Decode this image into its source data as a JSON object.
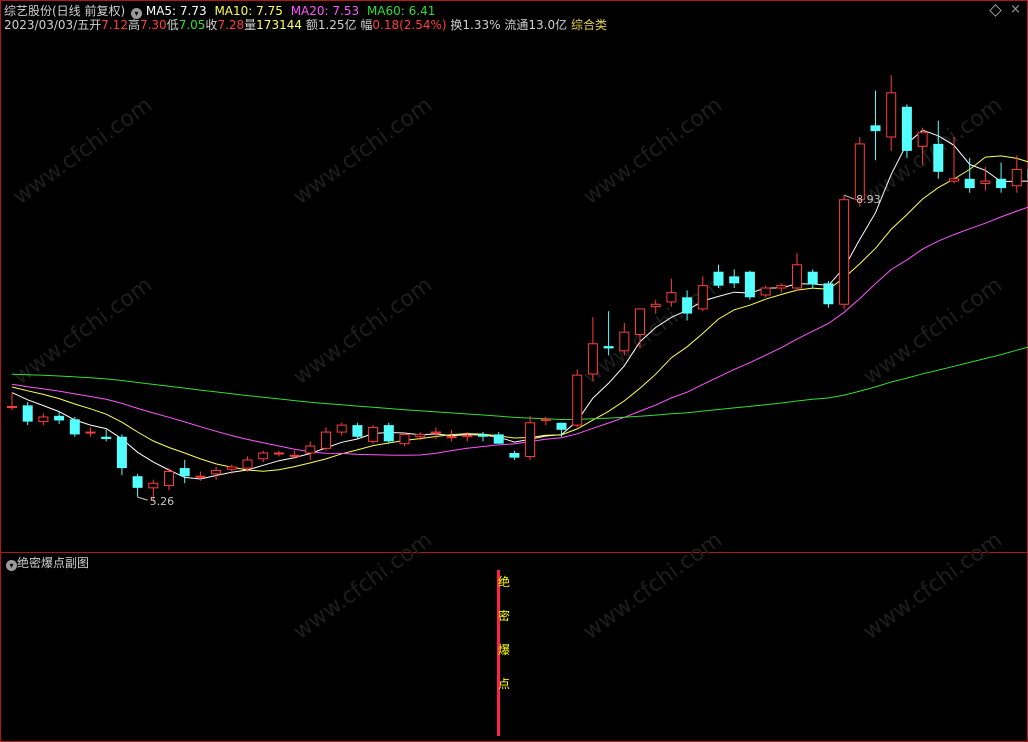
{
  "header": {
    "title": "综艺股份(日线 前复权)",
    "ma5": "MA5: 7.73",
    "ma10": "MA10: 7.75",
    "ma20": "MA20: 7.53",
    "ma60": "MA60: 6.41",
    "date": "2023/03/03/五",
    "open_label": "开",
    "open": "7.12",
    "high_label": "高",
    "high": "7.30",
    "low_label": "低",
    "low": "7.05",
    "close_label": "收",
    "close": "7.28",
    "vol_label": "量",
    "vol": "173144",
    "amount": "额1.25亿",
    "change_label": "幅",
    "change": "0.18(2.54%)",
    "turnover": "换1.33%",
    "float": "流通13.0亿",
    "sector": "综合类"
  },
  "sub_panel": {
    "title": "绝密爆点副图",
    "signal_chars": [
      "绝",
      "密",
      "爆",
      "点"
    ]
  },
  "watermark": "www.cfchi.com",
  "colors": {
    "up": "#ff3c3c",
    "down": "#54ffff",
    "ma5": "#ffffff",
    "ma10": "#ffff55",
    "ma20": "#ff55ff",
    "ma60": "#33dd33",
    "border": "#b01818",
    "signal": "#ff2244",
    "signal_text": "#ffff00"
  },
  "chart_data": {
    "type": "candlestick",
    "y_range_visible": [
      5.0,
      9.2
    ],
    "annotations": [
      {
        "label": "8.93",
        "candle_index": 53,
        "kind": "high"
      },
      {
        "label": "5.26",
        "candle_index": 8,
        "kind": "low"
      }
    ],
    "candles": [
      {
        "o": 6.08,
        "h": 6.2,
        "l": 6.05,
        "c": 6.08
      },
      {
        "o": 6.09,
        "h": 6.12,
        "l": 5.92,
        "c": 5.95
      },
      {
        "o": 5.95,
        "h": 6.02,
        "l": 5.92,
        "c": 5.99
      },
      {
        "o": 6.0,
        "h": 6.04,
        "l": 5.93,
        "c": 5.96
      },
      {
        "o": 5.97,
        "h": 5.99,
        "l": 5.82,
        "c": 5.84
      },
      {
        "o": 5.86,
        "h": 5.9,
        "l": 5.82,
        "c": 5.86
      },
      {
        "o": 5.82,
        "h": 5.88,
        "l": 5.78,
        "c": 5.8
      },
      {
        "o": 5.82,
        "h": 5.84,
        "l": 5.49,
        "c": 5.55
      },
      {
        "o": 5.48,
        "h": 5.5,
        "l": 5.3,
        "c": 5.38
      },
      {
        "o": 5.38,
        "h": 5.45,
        "l": 5.26,
        "c": 5.42
      },
      {
        "o": 5.4,
        "h": 5.55,
        "l": 5.36,
        "c": 5.52
      },
      {
        "o": 5.55,
        "h": 5.62,
        "l": 5.42,
        "c": 5.48
      },
      {
        "o": 5.48,
        "h": 5.52,
        "l": 5.44,
        "c": 5.48
      },
      {
        "o": 5.5,
        "h": 5.56,
        "l": 5.45,
        "c": 5.53
      },
      {
        "o": 5.54,
        "h": 5.58,
        "l": 5.5,
        "c": 5.56
      },
      {
        "o": 5.55,
        "h": 5.65,
        "l": 5.52,
        "c": 5.62
      },
      {
        "o": 5.63,
        "h": 5.7,
        "l": 5.6,
        "c": 5.68
      },
      {
        "o": 5.68,
        "h": 5.7,
        "l": 5.65,
        "c": 5.68
      },
      {
        "o": 5.66,
        "h": 5.7,
        "l": 5.63,
        "c": 5.66
      },
      {
        "o": 5.68,
        "h": 5.78,
        "l": 5.62,
        "c": 5.74
      },
      {
        "o": 5.72,
        "h": 5.9,
        "l": 5.7,
        "c": 5.86
      },
      {
        "o": 5.86,
        "h": 5.94,
        "l": 5.83,
        "c": 5.92
      },
      {
        "o": 5.92,
        "h": 5.94,
        "l": 5.8,
        "c": 5.82
      },
      {
        "o": 5.78,
        "h": 5.92,
        "l": 5.76,
        "c": 5.9
      },
      {
        "o": 5.92,
        "h": 5.94,
        "l": 5.76,
        "c": 5.78
      },
      {
        "o": 5.76,
        "h": 5.86,
        "l": 5.74,
        "c": 5.84
      },
      {
        "o": 5.82,
        "h": 5.86,
        "l": 5.79,
        "c": 5.84
      },
      {
        "o": 5.85,
        "h": 5.9,
        "l": 5.8,
        "c": 5.86
      },
      {
        "o": 5.82,
        "h": 5.88,
        "l": 5.78,
        "c": 5.82
      },
      {
        "o": 5.82,
        "h": 5.86,
        "l": 5.78,
        "c": 5.83
      },
      {
        "o": 5.84,
        "h": 5.86,
        "l": 5.78,
        "c": 5.82
      },
      {
        "o": 5.84,
        "h": 5.86,
        "l": 5.76,
        "c": 5.76
      },
      {
        "o": 5.68,
        "h": 5.7,
        "l": 5.62,
        "c": 5.64
      },
      {
        "o": 5.65,
        "h": 6.0,
        "l": 5.62,
        "c": 5.94
      },
      {
        "o": 5.96,
        "h": 5.99,
        "l": 5.92,
        "c": 5.97
      },
      {
        "o": 5.94,
        "h": 5.94,
        "l": 5.82,
        "c": 5.88
      },
      {
        "o": 5.92,
        "h": 6.4,
        "l": 5.9,
        "c": 6.35
      },
      {
        "o": 6.36,
        "h": 6.85,
        "l": 6.3,
        "c": 6.62
      },
      {
        "o": 6.6,
        "h": 6.9,
        "l": 6.52,
        "c": 6.58
      },
      {
        "o": 6.56,
        "h": 6.8,
        "l": 6.52,
        "c": 6.72
      },
      {
        "o": 6.7,
        "h": 6.92,
        "l": 6.58,
        "c": 6.92
      },
      {
        "o": 6.94,
        "h": 7.0,
        "l": 6.88,
        "c": 6.96
      },
      {
        "o": 6.98,
        "h": 7.18,
        "l": 6.94,
        "c": 7.06
      },
      {
        "o": 7.02,
        "h": 7.08,
        "l": 6.82,
        "c": 6.88
      },
      {
        "o": 6.92,
        "h": 7.2,
        "l": 6.9,
        "c": 7.12
      },
      {
        "o": 7.24,
        "h": 7.3,
        "l": 7.1,
        "c": 7.12
      },
      {
        "o": 7.2,
        "h": 7.26,
        "l": 7.1,
        "c": 7.14
      },
      {
        "o": 7.24,
        "h": 7.25,
        "l": 7.0,
        "c": 7.02
      },
      {
        "o": 7.04,
        "h": 7.12,
        "l": 7.02,
        "c": 7.1
      },
      {
        "o": 7.1,
        "h": 7.14,
        "l": 7.06,
        "c": 7.12
      },
      {
        "o": 7.1,
        "h": 7.4,
        "l": 7.08,
        "c": 7.3
      },
      {
        "o": 7.24,
        "h": 7.26,
        "l": 7.1,
        "c": 7.13
      },
      {
        "o": 7.14,
        "h": 7.16,
        "l": 6.93,
        "c": 6.96
      },
      {
        "o": 6.96,
        "h": 7.9,
        "l": 6.92,
        "c": 7.86
      },
      {
        "o": 7.86,
        "h": 8.4,
        "l": 7.8,
        "c": 8.34
      },
      {
        "o": 8.5,
        "h": 8.8,
        "l": 8.2,
        "c": 8.45
      },
      {
        "o": 8.4,
        "h": 8.93,
        "l": 8.28,
        "c": 8.78
      },
      {
        "o": 8.66,
        "h": 8.68,
        "l": 8.22,
        "c": 8.28
      },
      {
        "o": 8.32,
        "h": 8.48,
        "l": 8.16,
        "c": 8.44
      },
      {
        "o": 8.34,
        "h": 8.54,
        "l": 8.04,
        "c": 8.1
      },
      {
        "o": 8.02,
        "h": 8.4,
        "l": 8.0,
        "c": 8.04
      },
      {
        "o": 8.04,
        "h": 8.22,
        "l": 7.92,
        "c": 7.96
      },
      {
        "o": 8.0,
        "h": 8.14,
        "l": 7.94,
        "c": 8.02
      },
      {
        "o": 8.04,
        "h": 8.18,
        "l": 7.92,
        "c": 7.96
      },
      {
        "o": 7.98,
        "h": 8.24,
        "l": 7.92,
        "c": 8.12
      },
      {
        "o": 8.12,
        "h": 8.2,
        "l": 8.02,
        "c": 8.04
      },
      {
        "o": 8.04,
        "h": 8.12,
        "l": 7.94,
        "c": 7.96
      },
      {
        "o": 8.04,
        "h": 8.2,
        "l": 7.98,
        "c": 8.14
      }
    ]
  }
}
